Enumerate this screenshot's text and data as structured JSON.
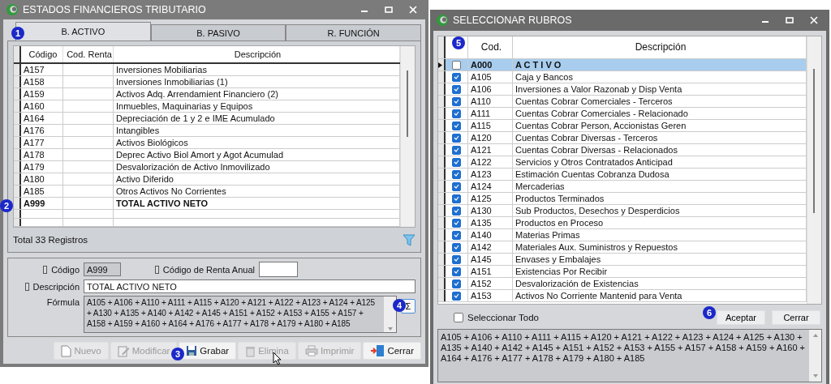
{
  "main_window": {
    "title": "ESTADOS FINANCIEROS TRIBUTARIO",
    "tabs": [
      {
        "label": "B. ACTIVO",
        "selected": true
      },
      {
        "label": "B. PASIVO",
        "selected": false
      },
      {
        "label": "R. FUNCIÓN",
        "selected": false
      }
    ],
    "table": {
      "columns": [
        "Código",
        "Cod. Renta",
        "Descripción"
      ],
      "rows": [
        {
          "code": "A157",
          "description": "Inversiones Mobiliarias",
          "bold": false
        },
        {
          "code": "A158",
          "description": "Inversiones Inmobiliarias (1)",
          "bold": false
        },
        {
          "code": "A159",
          "description": "Activos Adq. Arrendamient Financiero (2)",
          "bold": false
        },
        {
          "code": "A160",
          "description": "Inmuebles, Maquinarias y Equipos",
          "bold": false
        },
        {
          "code": "A164",
          "description": "Depreciación de 1 y 2 e IME Acumulado",
          "bold": false
        },
        {
          "code": "A176",
          "description": "Intangibles",
          "bold": false
        },
        {
          "code": "A177",
          "description": "Activos Biológicos",
          "bold": false
        },
        {
          "code": "A178",
          "description": "Deprec Activo Biol Amort y Agot Acumulad",
          "bold": false
        },
        {
          "code": "A179",
          "description": "Desvalorización de Activo Inmovilizado",
          "bold": false
        },
        {
          "code": "A180",
          "description": "Activo Diferido",
          "bold": false
        },
        {
          "code": "A185",
          "description": "Otros Activos No Corrientes",
          "bold": false
        },
        {
          "code": "A999",
          "description": "TOTAL ACTIVO NETO",
          "bold": true
        }
      ]
    },
    "record_count": "Total 33 Registros",
    "form": {
      "codigo_label": "Código",
      "codigo_value": "A999",
      "renta_label": "Código de Renta Anual",
      "descripcion_label": "Descripción",
      "descripcion_value": "TOTAL ACTIVO NETO",
      "formula_label": "Fórmula",
      "formula_value": "A105 + A106 + A110 + A111 + A115 + A120 + A121 + A122 + A123 + A124 + A125 + A130 + A135 + A140 + A142 + A145 + A151 + A152 + A153 + A155 + A157 + A158 + A159 + A160 + A164 + A176 + A177 + A178 + A179 + A180 + A185",
      "sum_button": "Σ"
    },
    "buttons": [
      {
        "kind": "new",
        "label": "Nuevo",
        "disabled": true
      },
      {
        "kind": "edit",
        "label": "Modificar",
        "disabled": true
      },
      {
        "kind": "save",
        "label": "Grabar",
        "disabled": false
      },
      {
        "kind": "delete",
        "label": "Elimina",
        "disabled": true
      },
      {
        "kind": "print",
        "label": "Imprimir",
        "disabled": true
      },
      {
        "kind": "close",
        "label": "Cerrar",
        "disabled": false
      }
    ]
  },
  "select_window": {
    "title": "SELECCIONAR RUBROS",
    "table": {
      "columns": [
        "Cod.",
        "Descripción"
      ],
      "rows": [
        {
          "code": "A000",
          "description": "A C T I V O",
          "checked": false,
          "selected": true
        },
        {
          "code": "A105",
          "description": "Caja y Bancos",
          "checked": true,
          "selected": false
        },
        {
          "code": "A106",
          "description": "Inversiones a Valor Razonab y Disp Venta",
          "checked": true,
          "selected": false
        },
        {
          "code": "A110",
          "description": "Cuentas Cobrar Comerciales - Terceros",
          "checked": true,
          "selected": false
        },
        {
          "code": "A111",
          "description": "Cuentas Cobrar Comerciales - Relacionado",
          "checked": true,
          "selected": false
        },
        {
          "code": "A115",
          "description": "Cuentas Cobrar Person, Accionistas Geren",
          "checked": true,
          "selected": false
        },
        {
          "code": "A120",
          "description": "Cuentas Cobrar Diversas - Terceros",
          "checked": true,
          "selected": false
        },
        {
          "code": "A121",
          "description": "Cuentas Cobrar Diversas - Relacionados",
          "checked": true,
          "selected": false
        },
        {
          "code": "A122",
          "description": "Servicios y Otros Contratados Anticipad",
          "checked": true,
          "selected": false
        },
        {
          "code": "A123",
          "description": "Estimación Cuentas Cobranza Dudosa",
          "checked": true,
          "selected": false
        },
        {
          "code": "A124",
          "description": "Mercaderias",
          "checked": true,
          "selected": false
        },
        {
          "code": "A125",
          "description": "Productos Terminados",
          "checked": true,
          "selected": false
        },
        {
          "code": "A130",
          "description": "Sub Productos, Desechos y Desperdicios",
          "checked": true,
          "selected": false
        },
        {
          "code": "A135",
          "description": "Productos en Proceso",
          "checked": true,
          "selected": false
        },
        {
          "code": "A140",
          "description": "Materias Primas",
          "checked": true,
          "selected": false
        },
        {
          "code": "A142",
          "description": "Materiales Aux. Suministros y Repuestos",
          "checked": true,
          "selected": false
        },
        {
          "code": "A145",
          "description": "Envases y Embalajes",
          "checked": true,
          "selected": false
        },
        {
          "code": "A151",
          "description": "Existencias Por Recibir",
          "checked": true,
          "selected": false
        },
        {
          "code": "A152",
          "description": "Desvalorización de Existencias",
          "checked": true,
          "selected": false
        },
        {
          "code": "A153",
          "description": "Activos No Corriente Mantenid para Venta",
          "checked": true,
          "selected": false
        }
      ]
    },
    "select_all": {
      "label": "Seleccionar Todo",
      "checked": false
    },
    "buttons": [
      "Aceptar",
      "Cerrar"
    ],
    "formula": "A105 + A106 + A110 + A111 + A115 + A120 + A121 + A122 + A123 + A124 + A125 + A130 + A135 + A140 + A142 + A145 + A151 + A152 + A153 + A155 + A157 + A158 + A159 + A160 + A164 + A176 + A177 + A178 + A179 + A180 + A185"
  },
  "callouts": [
    "1",
    "2",
    "3",
    "4",
    "5",
    "6"
  ]
}
